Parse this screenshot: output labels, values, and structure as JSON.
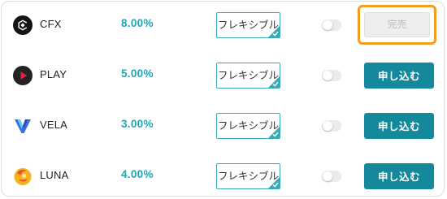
{
  "products": [
    {
      "coin": "CFX",
      "icon": "cfx-logo-icon",
      "rate": "8.00%",
      "term": "フレキシブル",
      "auto_renew": false,
      "action_label": "完売",
      "action_state": "sold-out"
    },
    {
      "coin": "PLAY",
      "icon": "play-logo-icon",
      "rate": "5.00%",
      "term": "フレキシブル",
      "auto_renew": false,
      "action_label": "申し込む",
      "action_state": "available"
    },
    {
      "coin": "VELA",
      "icon": "vela-logo-icon",
      "rate": "3.00%",
      "term": "フレキシブル",
      "auto_renew": false,
      "action_label": "申し込む",
      "action_state": "available"
    },
    {
      "coin": "LUNA",
      "icon": "luna-logo-icon",
      "rate": "4.00%",
      "term": "フレキシブル",
      "auto_renew": false,
      "action_label": "申し込む",
      "action_state": "available"
    }
  ],
  "colors": {
    "rate": "#25a2b3",
    "apply_button": "#15899c",
    "highlight": "#f39c1f",
    "sold_out_button": "#eeeeef"
  }
}
